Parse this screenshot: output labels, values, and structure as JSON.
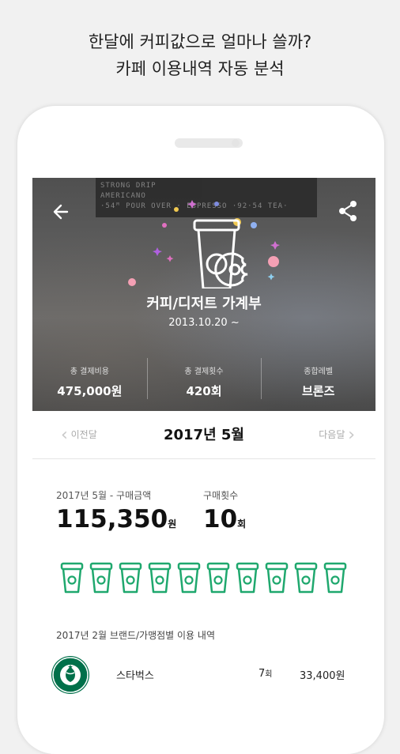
{
  "promo": {
    "line1": "한달에 커피값으로 얼마나 쓸까?",
    "line2": "카페 이용내역 자동 분석"
  },
  "hero": {
    "title": "커피/디저트 가계부",
    "date": "2013.10.20 ~",
    "menu_board": [
      "STRONG DRIP",
      "AMERICANO",
      "·54ᴹ POUR OVER · ESPRESSO ·92·54 TEA·"
    ],
    "stats": [
      {
        "label": "총 결제비용",
        "value": "475,000원"
      },
      {
        "label": "총 결제횟수",
        "value": "420회"
      },
      {
        "label": "종합레벨",
        "value": "브론즈"
      }
    ]
  },
  "month_nav": {
    "prev_label": "이전달",
    "title": "2017년 5월",
    "next_label": "다음달"
  },
  "summary": {
    "amount_label": "2017년 5월 - 구매금액",
    "amount_value": "115,350",
    "amount_unit": "원",
    "count_label": "구매횟수",
    "count_value": "10",
    "count_unit": "회",
    "cup_count": 10
  },
  "brand_section": {
    "title": "2017년 2월 브랜드/가맹점별 이용 내역",
    "rows": [
      {
        "name": "스타벅스",
        "count": "7",
        "count_unit": "회",
        "amount": "33,400원"
      }
    ]
  },
  "colors": {
    "accent_green": "#1fa86e",
    "starbucks_green": "#00704a"
  }
}
